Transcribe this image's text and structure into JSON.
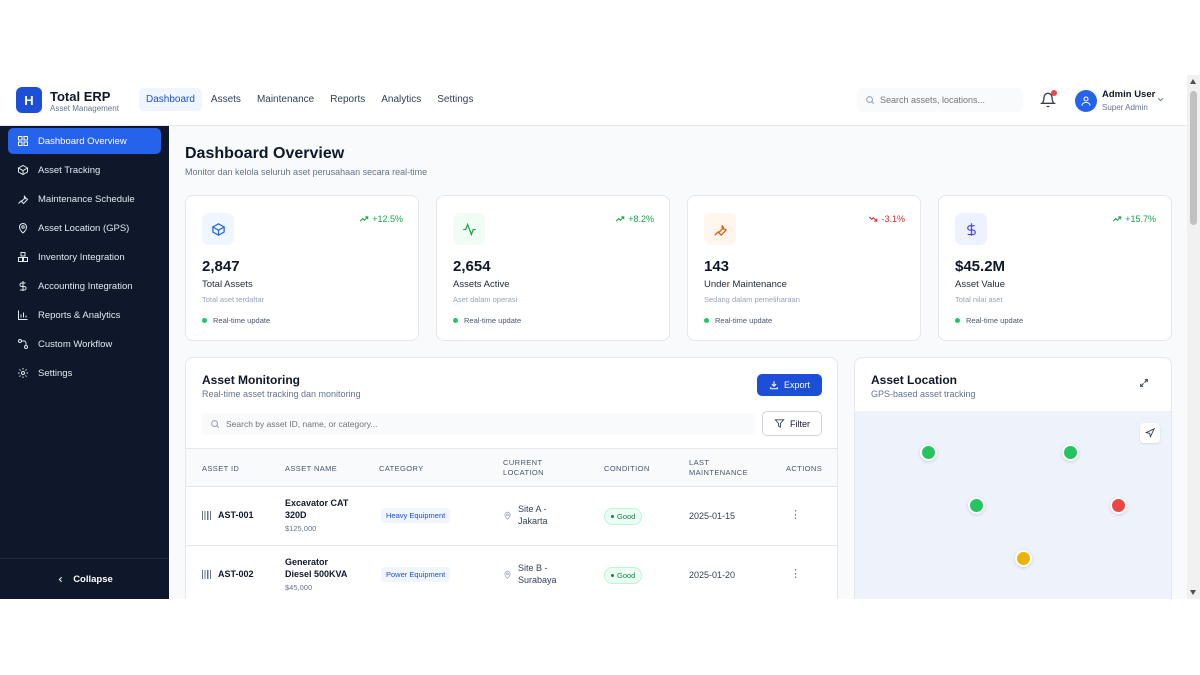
{
  "brand": {
    "logo_letter": "H",
    "name": "Total ERP",
    "subtitle": "Asset Management"
  },
  "nav": [
    {
      "label": "Dashboard",
      "active": true
    },
    {
      "label": "Assets"
    },
    {
      "label": "Maintenance"
    },
    {
      "label": "Reports"
    },
    {
      "label": "Analytics"
    },
    {
      "label": "Settings"
    }
  ],
  "search": {
    "placeholder": "Search assets, locations..."
  },
  "user": {
    "name": "Admin User",
    "role": "Super Admin"
  },
  "sidebar": {
    "items": [
      {
        "label": "Dashboard Overview",
        "icon": "grid-icon",
        "active": true
      },
      {
        "label": "Asset Tracking",
        "icon": "box-icon"
      },
      {
        "label": "Maintenance Schedule",
        "icon": "wrench-icon"
      },
      {
        "label": "Asset Location (GPS)",
        "icon": "map-pin-icon"
      },
      {
        "label": "Inventory Integration",
        "icon": "boxes-icon"
      },
      {
        "label": "Accounting Integration",
        "icon": "dollar-icon"
      },
      {
        "label": "Reports & Analytics",
        "icon": "bar-chart-icon"
      },
      {
        "label": "Custom Workflow",
        "icon": "workflow-icon"
      },
      {
        "label": "Settings",
        "icon": "gear-icon"
      }
    ],
    "collapse_label": "Collapse"
  },
  "page": {
    "title": "Dashboard Overview",
    "subtitle": "Monitor dan kelola seluruh aset perusahaan secara real-time"
  },
  "stats": [
    {
      "value": "2,847",
      "label": "Total Assets",
      "sub": "Total aset terdaftar",
      "trend": "+12.5%",
      "trend_dir": "up",
      "icon": "box-icon",
      "color": "#2563eb",
      "bg": "#eff6ff",
      "status": "Real-time update"
    },
    {
      "value": "2,654",
      "label": "Assets Active",
      "sub": "Aset dalam operasi",
      "trend": "+8.2%",
      "trend_dir": "up",
      "icon": "activity-icon",
      "color": "#16a34a",
      "bg": "#f0fdf4",
      "status": "Real-time update"
    },
    {
      "value": "143",
      "label": "Under Maintenance",
      "sub": "Sedang dalam pemeliharaan",
      "trend": "-3.1%",
      "trend_dir": "down",
      "icon": "wrench-icon",
      "color": "#ea580c",
      "bg": "#fff7ed",
      "status": "Real-time update"
    },
    {
      "value": "$45.2M",
      "label": "Asset Value",
      "sub": "Total nilai aset",
      "trend": "+15.7%",
      "trend_dir": "up",
      "icon": "dollar-icon",
      "color": "#4f46e5",
      "bg": "#eef2ff",
      "status": "Real-time update"
    }
  ],
  "monitoring": {
    "title": "Asset Monitoring",
    "subtitle": "Real-time asset tracking dan monitoring",
    "export_label": "Export",
    "search_placeholder": "Search by asset ID, name, or category...",
    "filter_label": "Filter",
    "headers": {
      "id": "ASSET ID",
      "name": "ASSET NAME",
      "category": "CATEGORY",
      "location_1": "CURRENT",
      "location_2": "LOCATION",
      "condition": "CONDITION",
      "maint_1": "LAST",
      "maint_2": "MAINTENANCE",
      "actions": "ACTIONS"
    },
    "rows": [
      {
        "id": "AST-001",
        "name": "Excavator CAT 320D",
        "price": "$125,000",
        "category": "Heavy Equipment",
        "location": "Site A - Jakarta",
        "condition": "Good",
        "last_maintenance": "2025-01-15"
      },
      {
        "id": "AST-002",
        "name": "Generator Diesel 500KVA",
        "price": "$45,000",
        "category": "Power Equipment",
        "location": "Site B - Surabaya",
        "condition": "Good",
        "last_maintenance": "2025-01-20"
      }
    ]
  },
  "map": {
    "title": "Asset Location",
    "subtitle": "GPS-based asset tracking",
    "pins": [
      {
        "status": "active",
        "color": "#22c55e"
      },
      {
        "status": "active",
        "color": "#22c55e"
      },
      {
        "status": "active",
        "color": "#22c55e"
      },
      {
        "status": "alert",
        "color": "#ef4444"
      },
      {
        "status": "warning",
        "color": "#eab308"
      }
    ]
  }
}
